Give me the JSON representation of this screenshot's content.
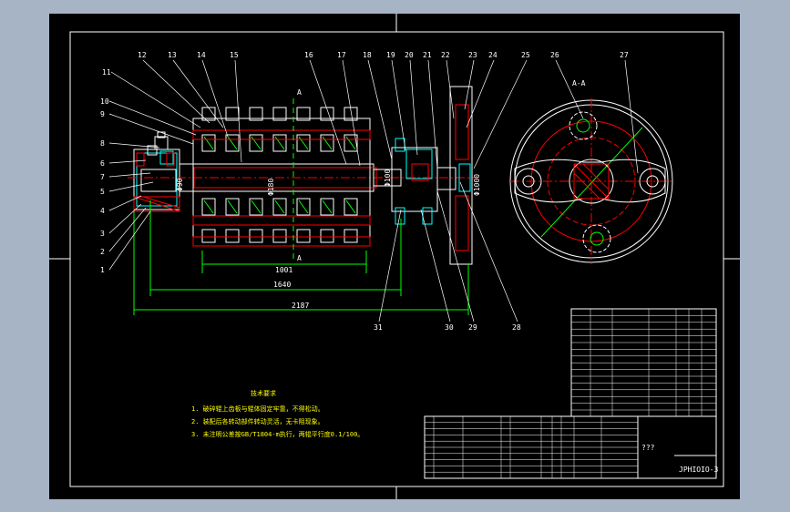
{
  "drawing": {
    "section_label": "A-A",
    "cut_label_top": "A",
    "cut_label_bottom": "A",
    "balloons_top": [
      "12",
      "13",
      "14",
      "15",
      "16",
      "17",
      "18",
      "19",
      "20",
      "21",
      "22",
      "23",
      "24",
      "25",
      "26",
      "27"
    ],
    "balloons_left": [
      "11",
      "10",
      "9",
      "8",
      "6",
      "7",
      "5",
      "4",
      "3",
      "2",
      "1"
    ],
    "balloons_bottom": [
      "31",
      "30",
      "29",
      "28"
    ],
    "dimensions": {
      "d1": "1001",
      "d2": "1640",
      "d3": "2187",
      "dia_shaft": "Φ180",
      "dia_hub": "Φ100",
      "dia_wheel": "Φ1000",
      "dia_small": "Φ90"
    }
  },
  "notes": {
    "title": "技术要求",
    "lines": [
      "1. 破碎辊上齿板与辊体固定牢靠，不得松动。",
      "2. 装配后各转动部件转动灵活，无卡阻现象。",
      "3. 未注明公差按GB/T1804-m执行，两辊平行度0.1/100。"
    ]
  },
  "title_block": {
    "unknown_field": "???",
    "drawing_number": "JPHIOIO-3"
  },
  "colors": {
    "sheet": "#000000",
    "border": "#ffffff",
    "part": "#ffffff",
    "hatch": "#ff0000",
    "dimension": "#00ff00",
    "center": "#ff0000",
    "cyan": "#00ffff",
    "yellow": "#ffff00",
    "desktop": "#a7b4c6"
  }
}
